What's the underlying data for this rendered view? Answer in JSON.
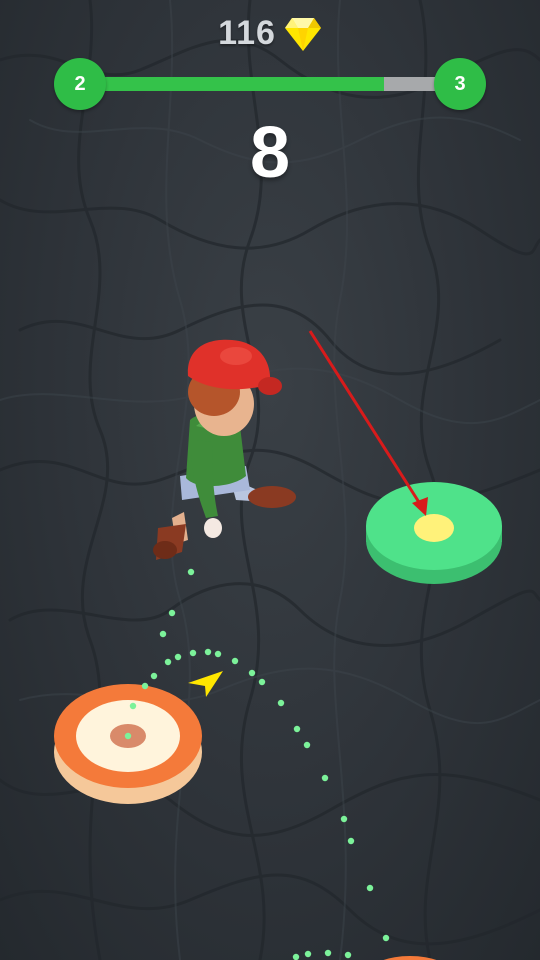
{
  "hud": {
    "gem_count": "116",
    "gem_icon": "diamond-icon",
    "level_current": "2",
    "level_next": "3",
    "level_progress": 0.8,
    "score": "8"
  },
  "colors": {
    "accent_green": "#34c24a",
    "gem_yellow": "#ffe600",
    "target_orange": "#f47a3a",
    "platform_green": "#4fe28a",
    "trajectory_dots": "#7cf29a",
    "aim_arrow": "#d81b1b"
  },
  "scene": {
    "character": "red-cap-boy",
    "start_platform": "orange-ring-platform",
    "target_platform": "green-platform",
    "direction_marker": "yellow-arrow"
  }
}
